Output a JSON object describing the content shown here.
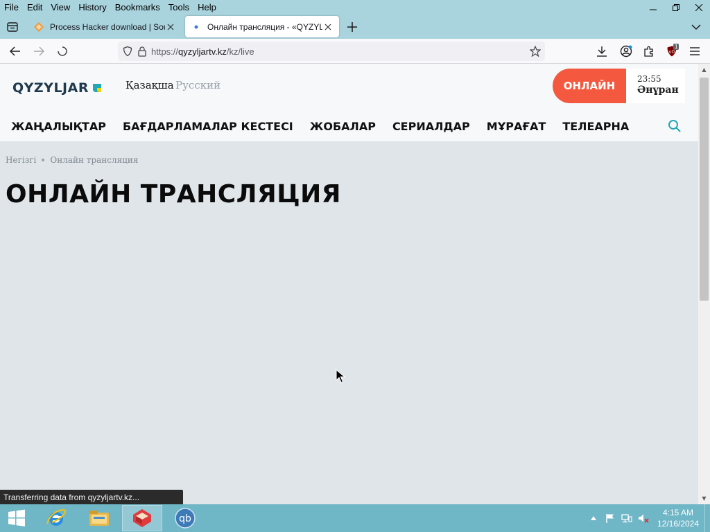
{
  "menubar": {
    "items": [
      "File",
      "Edit",
      "View",
      "History",
      "Bookmarks",
      "Tools",
      "Help"
    ]
  },
  "tabs": [
    {
      "title": "Process Hacker download | Sou",
      "active": false
    },
    {
      "title": "Онлайн трансляция - «QYZYL",
      "active": true
    }
  ],
  "navbar": {
    "url_prefix": "https://",
    "url_host": "qyzyljartv.kz",
    "url_path": "/kz/live",
    "ublock_badge": "1"
  },
  "site": {
    "logo_text": "QYZYLJAR",
    "lang_kz": "Қазақша",
    "lang_ru": "Русский",
    "online_button": "ОНЛАЙН",
    "online_time": "23:55",
    "online_show": "Әнұран",
    "nav": [
      "ЖАҢАЛЫҚТАР",
      "БАҒДАРЛАМАЛАР КЕСТЕСІ",
      "ЖОБАЛАР",
      "СЕРИАЛДАР",
      "МҰРАҒАТ",
      "ТЕЛЕАРНА"
    ],
    "breadcrumb": [
      "Негізгі",
      "Онлайн трансляция"
    ],
    "page_title": "ОНЛАЙН ТРАНСЛЯЦИЯ"
  },
  "status_text": "Transferring data from qyzyljartv.kz...",
  "taskbar": {
    "time": "4:15 AM",
    "date": "12/16/2024"
  },
  "colors": {
    "chrome": "#a9d3dd",
    "accent_online": "#f4593f",
    "taskbar": "#6fb6c6"
  }
}
